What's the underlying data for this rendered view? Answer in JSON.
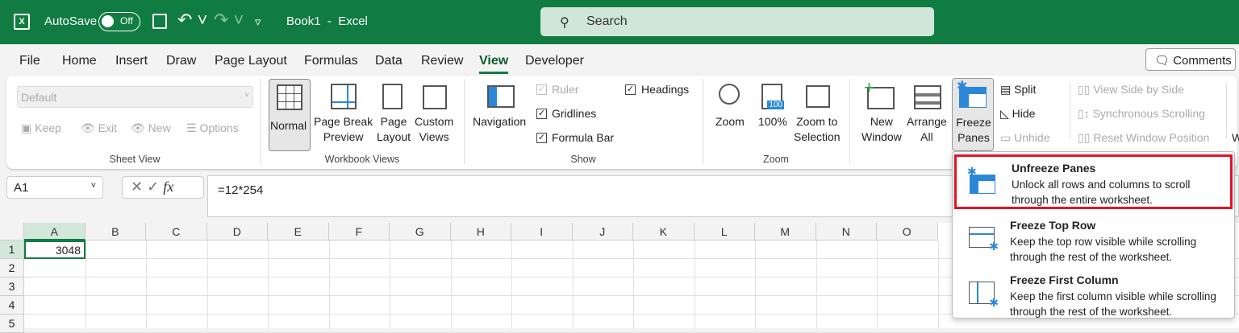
{
  "title_bar": {
    "autosave_label": "AutoSave",
    "autosave_state": "Off",
    "doc_title": "Book1  -  Excel",
    "search_placeholder": "Search"
  },
  "tabs": [
    "File",
    "Home",
    "Insert",
    "Draw",
    "Page Layout",
    "Formulas",
    "Data",
    "Review",
    "View",
    "Developer"
  ],
  "active_tab": "View",
  "comments_label": "Comments",
  "ribbon": {
    "sheet_view": {
      "dropdown": "Default",
      "keep": "Keep",
      "exit": "Exit",
      "new": "New",
      "options": "Options",
      "label": "Sheet View"
    },
    "workbook_views": {
      "normal": "Normal",
      "page_break_1": "Page Break",
      "page_break_2": "Preview",
      "page_layout_1": "Page",
      "page_layout_2": "Layout",
      "custom_1": "Custom",
      "custom_2": "Views",
      "label": "Workbook Views"
    },
    "show": {
      "navigation": "Navigation",
      "ruler": "Ruler",
      "gridlines": "Gridlines",
      "formula_bar": "Formula Bar",
      "headings": "Headings",
      "label": "Show"
    },
    "zoom": {
      "zoom": "Zoom",
      "hundred": "100%",
      "zoom_sel_1": "Zoom to",
      "zoom_sel_2": "Selection",
      "label": "Zoom"
    },
    "window": {
      "new_1": "New",
      "new_2": "Window",
      "arrange_1": "Arrange",
      "arrange_2": "All",
      "freeze_1": "Freeze",
      "freeze_2": "Panes",
      "split": "Split",
      "hide": "Hide",
      "unhide": "Unhide",
      "side_by_side": "View Side by Side",
      "sync": "Synchronous Scrolling",
      "reset": "Reset Window Position",
      "more": "W"
    }
  },
  "formula_bar": {
    "name_box": "A1",
    "formula": "=12*254",
    "fx": "fx"
  },
  "grid": {
    "columns": [
      "A",
      "B",
      "C",
      "D",
      "E",
      "F",
      "G",
      "H",
      "I",
      "J",
      "K",
      "L",
      "M",
      "N",
      "O"
    ],
    "rows": [
      "1",
      "2",
      "3",
      "4",
      "5"
    ],
    "cell_a1": "3048"
  },
  "freeze_menu": [
    {
      "title": "Unfreeze Panes",
      "desc": "Unlock all rows and columns to scroll through the entire worksheet."
    },
    {
      "title": "Freeze Top Row",
      "desc": "Keep the top row visible while scrolling through the rest of the worksheet."
    },
    {
      "title": "Freeze First Column",
      "desc": "Keep the first column visible while scrolling through the rest of the worksheet."
    }
  ],
  "colors": {
    "brand": "#107c41",
    "highlight": "#e81123",
    "accent": "#2b88d8"
  }
}
